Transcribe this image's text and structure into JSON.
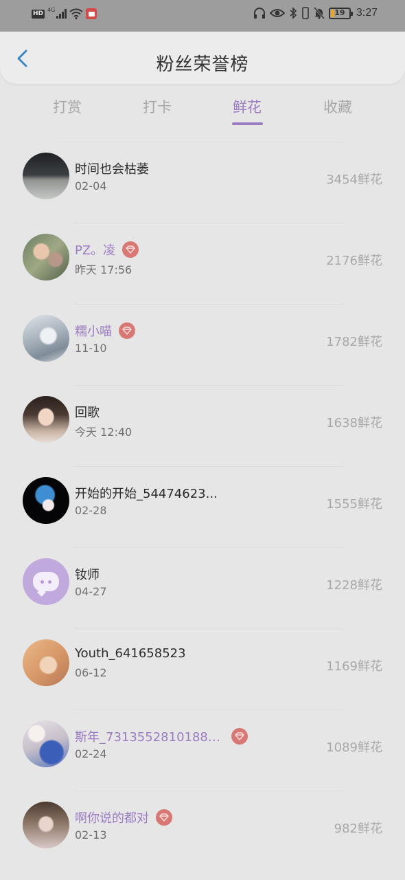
{
  "status_bar": {
    "hd": "HD",
    "network": "4G",
    "battery": "19",
    "battery_level": 0.19,
    "time": "3:27",
    "icons": [
      "signal-icon",
      "wifi-icon",
      "app-notification-icon",
      "headphones-icon",
      "eye-icon",
      "bluetooth-icon",
      "vibrate-icon",
      "mute-bell-icon",
      "battery-icon"
    ]
  },
  "header": {
    "title": "粉丝荣誉榜"
  },
  "tabs": [
    {
      "label": "打赏",
      "active": false
    },
    {
      "label": "打卡",
      "active": false
    },
    {
      "label": "鲜花",
      "active": true
    },
    {
      "label": "收藏",
      "active": false
    }
  ],
  "list": [
    {
      "name": "时间也会枯萎",
      "date": "02-04",
      "amount": "3454鲜花",
      "vip": false
    },
    {
      "name": "PZ。凌",
      "date": "昨天 17:56",
      "amount": "2176鲜花",
      "vip": true
    },
    {
      "name": "糯小喵",
      "date": "11-10",
      "amount": "1782鲜花",
      "vip": true
    },
    {
      "name": "回歌",
      "date": "今天 12:40",
      "amount": "1638鲜花",
      "vip": false
    },
    {
      "name": "开始的开始_54474623...",
      "date": "02-28",
      "amount": "1555鲜花",
      "vip": false
    },
    {
      "name": "钕师",
      "date": "04-27",
      "amount": "1228鲜花",
      "vip": false
    },
    {
      "name": "Youth_641658523",
      "date": "06-12",
      "amount": "1169鲜花",
      "vip": false
    },
    {
      "name": "斯年_73135528101883...",
      "date": "02-24",
      "amount": "1089鲜花",
      "vip": true
    },
    {
      "name": "啊你说的都对",
      "date": "02-13",
      "amount": "982鲜花",
      "vip": true
    }
  ],
  "colors": {
    "accent": "#9b7cc2",
    "vip_badge": "#d77875",
    "background": "#e6e6e6",
    "status_bar": "#9d9d9d"
  }
}
